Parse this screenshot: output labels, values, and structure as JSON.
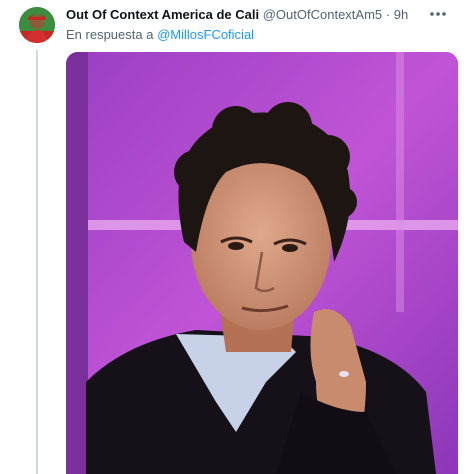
{
  "tweet": {
    "author_name": "Out Of Context America de Cali",
    "author_handle": "@OutOfContextAm5",
    "separator": "·",
    "time": "9h",
    "reply_prefix": "En respuesta a",
    "reply_to": "@MillosFCoficial",
    "more_icon": "more-horizontal-icon"
  },
  "colors": {
    "text_primary": "#0f1419",
    "text_secondary": "#536471",
    "link": "#1d9bf0",
    "thread_line": "#cfd9de",
    "media_background": "#b04ccf"
  }
}
